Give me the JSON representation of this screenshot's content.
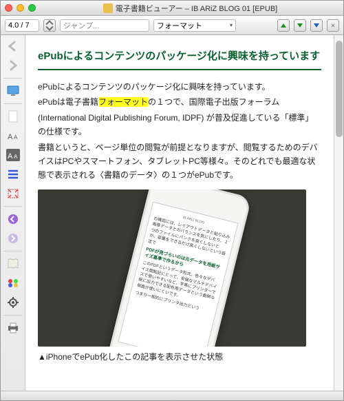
{
  "window": {
    "title": "電子書籍ビューアー – IB ARiZ BLOG 01 [EPUB]"
  },
  "toolbar": {
    "page": "4.0 / 7",
    "jump_placeholder": "ジャンプ...",
    "format_label": "フォーマット"
  },
  "article": {
    "heading": "ePubによるコンテンツのパッケージ化に興味を持っています",
    "p1_a": "ePubによるコンテンツのパッケージ化に興味を持っています。",
    "p2_a": "ePubは電子書籍",
    "p2_hl": "フォーマット",
    "p2_b": "の１つで、国際電子出版フォーラム",
    "p3": "(International Digital Publishing Forum, IDPF) が普及促進している「標準」の仕様です。",
    "p4": "書籍というと、ページ単位の閲覧が前提となりますが、閲覧するためのデバイスはPCやスマートフォン、タブレットPC等様々。そのどれでも最適な状態で表示される〈書籍のデータ〉の１つがePubです。",
    "caption": "▲iPhoneでePub化したこの記事を表示させた状態"
  },
  "phone": {
    "blog_title": "IB ARiZ BLOG",
    "para1": "の確認には、レイアウトデータと貼り込み画像データとのバランスを気にしたり、１つのファイルにパンクを高くしないとか、容量をできるだけ高くしないという設定で",
    "head": "PDFが見づらいのは元データを用紙サイズ基準で作るから",
    "para2": "このPDFというデータ形式、色々なデバイス間転記にとって、安価なマルチデバイスで使いやすいなど、平等にプリンターで紙に出力できる配布用データという面倒な側面が使いにくいです。",
    "para3": "つまり一般的にプリンタ出力という"
  }
}
